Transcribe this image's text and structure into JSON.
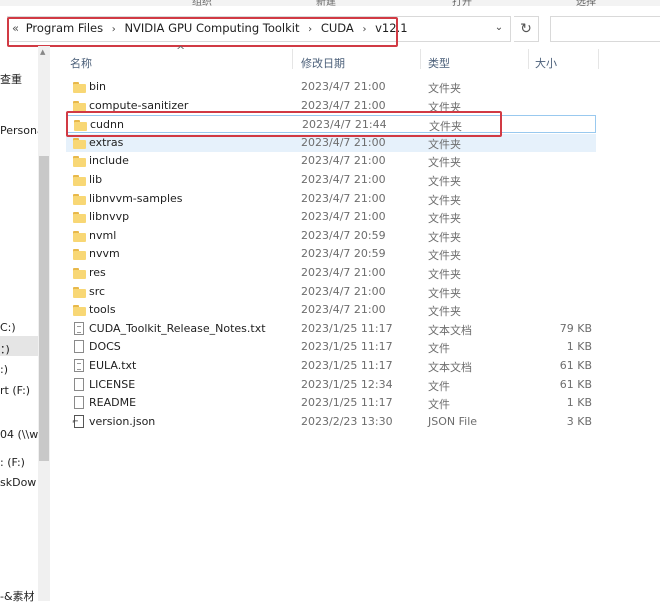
{
  "ribbon": {
    "labels": [
      "组织",
      "新建",
      "打开",
      "选择"
    ]
  },
  "address": {
    "overflow_glyph": "«",
    "crumbs": [
      "Program Files",
      "NVIDIA GPU Computing Toolkit",
      "CUDA",
      "v12.1"
    ],
    "separator": "›",
    "dropdown_glyph": "⌄",
    "refresh_glyph": "↻"
  },
  "sidebar": {
    "items": [
      "查重",
      "Persona",
      "C:)",
      "：)",
      ":)",
      "rt (F:)",
      "04 (\\\\w",
      ": (F:)",
      "skDow",
      "-&素材"
    ]
  },
  "columns": {
    "name": "名称",
    "date": "修改日期",
    "type": "类型",
    "size": "大小",
    "sort_glyph": "^"
  },
  "files": [
    {
      "name": "bin",
      "date": "2023/4/7 21:00",
      "type": "文件夹",
      "size": "",
      "kind": "folder"
    },
    {
      "name": "compute-sanitizer",
      "date": "2023/4/7 21:00",
      "type": "文件夹",
      "size": "",
      "kind": "folder"
    },
    {
      "name": "cudnn",
      "date": "2023/4/7 21:44",
      "type": "文件夹",
      "size": "",
      "kind": "folder"
    },
    {
      "name": "extras",
      "date": "2023/4/7 21:00",
      "type": "文件夹",
      "size": "",
      "kind": "folder"
    },
    {
      "name": "include",
      "date": "2023/4/7 21:00",
      "type": "文件夹",
      "size": "",
      "kind": "folder"
    },
    {
      "name": "lib",
      "date": "2023/4/7 21:00",
      "type": "文件夹",
      "size": "",
      "kind": "folder"
    },
    {
      "name": "libnvvm-samples",
      "date": "2023/4/7 21:00",
      "type": "文件夹",
      "size": "",
      "kind": "folder"
    },
    {
      "name": "libnvvp",
      "date": "2023/4/7 21:00",
      "type": "文件夹",
      "size": "",
      "kind": "folder"
    },
    {
      "name": "nvml",
      "date": "2023/4/7 20:59",
      "type": "文件夹",
      "size": "",
      "kind": "folder"
    },
    {
      "name": "nvvm",
      "date": "2023/4/7 20:59",
      "type": "文件夹",
      "size": "",
      "kind": "folder"
    },
    {
      "name": "res",
      "date": "2023/4/7 21:00",
      "type": "文件夹",
      "size": "",
      "kind": "folder"
    },
    {
      "name": "src",
      "date": "2023/4/7 21:00",
      "type": "文件夹",
      "size": "",
      "kind": "folder"
    },
    {
      "name": "tools",
      "date": "2023/4/7 21:00",
      "type": "文件夹",
      "size": "",
      "kind": "folder"
    },
    {
      "name": "CUDA_Toolkit_Release_Notes.txt",
      "date": "2023/1/25 11:17",
      "type": "文本文档",
      "size": "79 KB",
      "kind": "doc"
    },
    {
      "name": "DOCS",
      "date": "2023/1/25 11:17",
      "type": "文件",
      "size": "1 KB",
      "kind": "file"
    },
    {
      "name": "EULA.txt",
      "date": "2023/1/25 11:17",
      "type": "文本文档",
      "size": "61 KB",
      "kind": "doc"
    },
    {
      "name": "LICENSE",
      "date": "2023/1/25 12:34",
      "type": "文件",
      "size": "61 KB",
      "kind": "file"
    },
    {
      "name": "README",
      "date": "2023/1/25 11:17",
      "type": "文件",
      "size": "1 KB",
      "kind": "file"
    },
    {
      "name": "version.json",
      "date": "2023/2/23 13:30",
      "type": "JSON File",
      "size": "3 KB",
      "kind": "json"
    }
  ],
  "colors": {
    "highlight_box": "#d13a44",
    "selection": "#e6f1fb",
    "folder": "#f8d775"
  }
}
